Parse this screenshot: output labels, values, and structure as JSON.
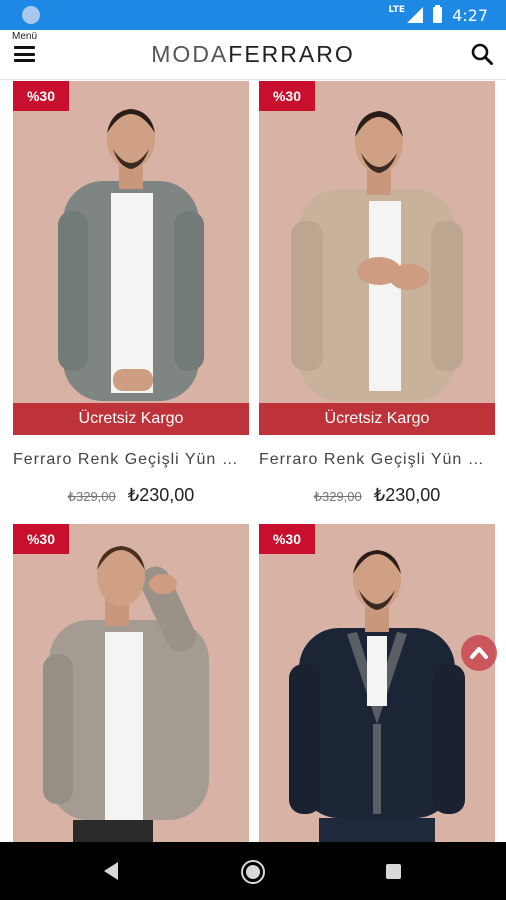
{
  "status_bar": {
    "network": "LTE",
    "time": "4:27"
  },
  "header": {
    "menu_label": "Menü",
    "brand_light": "MODA",
    "brand_bold": "FERRARO",
    "icons": {
      "menu": "hamburger-icon",
      "search": "search-icon"
    }
  },
  "colors": {
    "status_bar": "#1e88e5",
    "badge": "#c8102e",
    "cargo_banner": "#b9202a",
    "photo_background": "#d9b2a6"
  },
  "products": [
    {
      "discount": "%30",
      "cargo": "Ücretsiz Kargo",
      "name": "Ferraro Renk Geçişli Yün Hırka",
      "old_price": "₺329,00",
      "new_price": "₺230,00",
      "cardigan_color": "#7e8583"
    },
    {
      "discount": "%30",
      "cargo": "Ücretsiz Kargo",
      "name": "Ferraro Renk Geçişli Yün Hırka",
      "old_price": "₺329,00",
      "new_price": "₺230,00",
      "cardigan_color": "#c8b29c"
    },
    {
      "discount": "%30",
      "cardigan_color": "#a49c92"
    },
    {
      "discount": "%30",
      "cardigan_color": "#1c2536"
    }
  ],
  "scroll_top_icon": "chevron-up-icon",
  "nav": {
    "back_icon": "back-triangle-icon",
    "home_icon": "home-circle-icon",
    "recent_icon": "recent-apps-icon"
  }
}
